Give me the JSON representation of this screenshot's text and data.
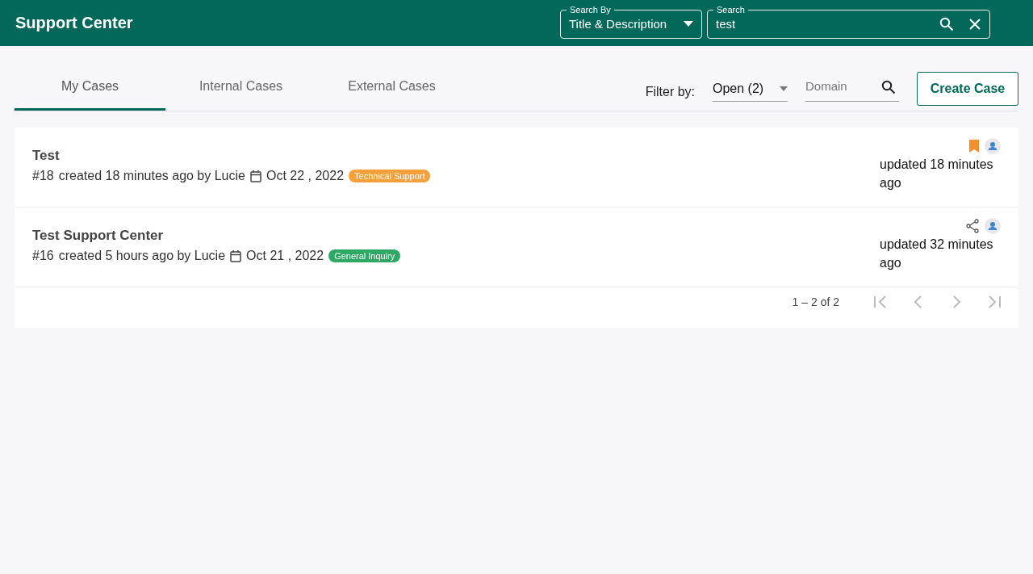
{
  "header": {
    "title": "Support Center",
    "search_by": {
      "label": "Search By",
      "value": "Title & Description"
    },
    "search": {
      "label": "Search",
      "value": "test"
    }
  },
  "tabs": [
    {
      "label": "My Cases",
      "selected": true
    },
    {
      "label": "Internal Cases",
      "selected": false
    },
    {
      "label": "External Cases",
      "selected": false
    }
  ],
  "filter": {
    "label": "Filter by:",
    "status": "Open (2)",
    "domain_placeholder": "Domain"
  },
  "create_button": "Create Case",
  "cases": [
    {
      "title": "Test",
      "number": "#18",
      "created": "created 18 minutes ago by Lucie",
      "date": "Oct 22 , 2022",
      "tag": "Technical Support",
      "color": "#f6a03c",
      "kind": "bookmark",
      "updated": "updated 18 minutes ago"
    },
    {
      "title": "Test Support Center",
      "number": "#16",
      "created": "created 5 hours ago by Lucie",
      "date": "Oct 21 , 2022",
      "tag": "General Inquiry",
      "color": "#2fa866",
      "kind": "share",
      "updated": "updated 32 minutes ago"
    }
  ],
  "pagination": {
    "range": "1 – 2 of 2",
    "buttons": [
      {
        "kind": "first",
        "disabled": true
      },
      {
        "kind": "prev",
        "disabled": true
      },
      {
        "kind": "next",
        "disabled": true
      },
      {
        "kind": "last",
        "disabled": true
      }
    ]
  }
}
